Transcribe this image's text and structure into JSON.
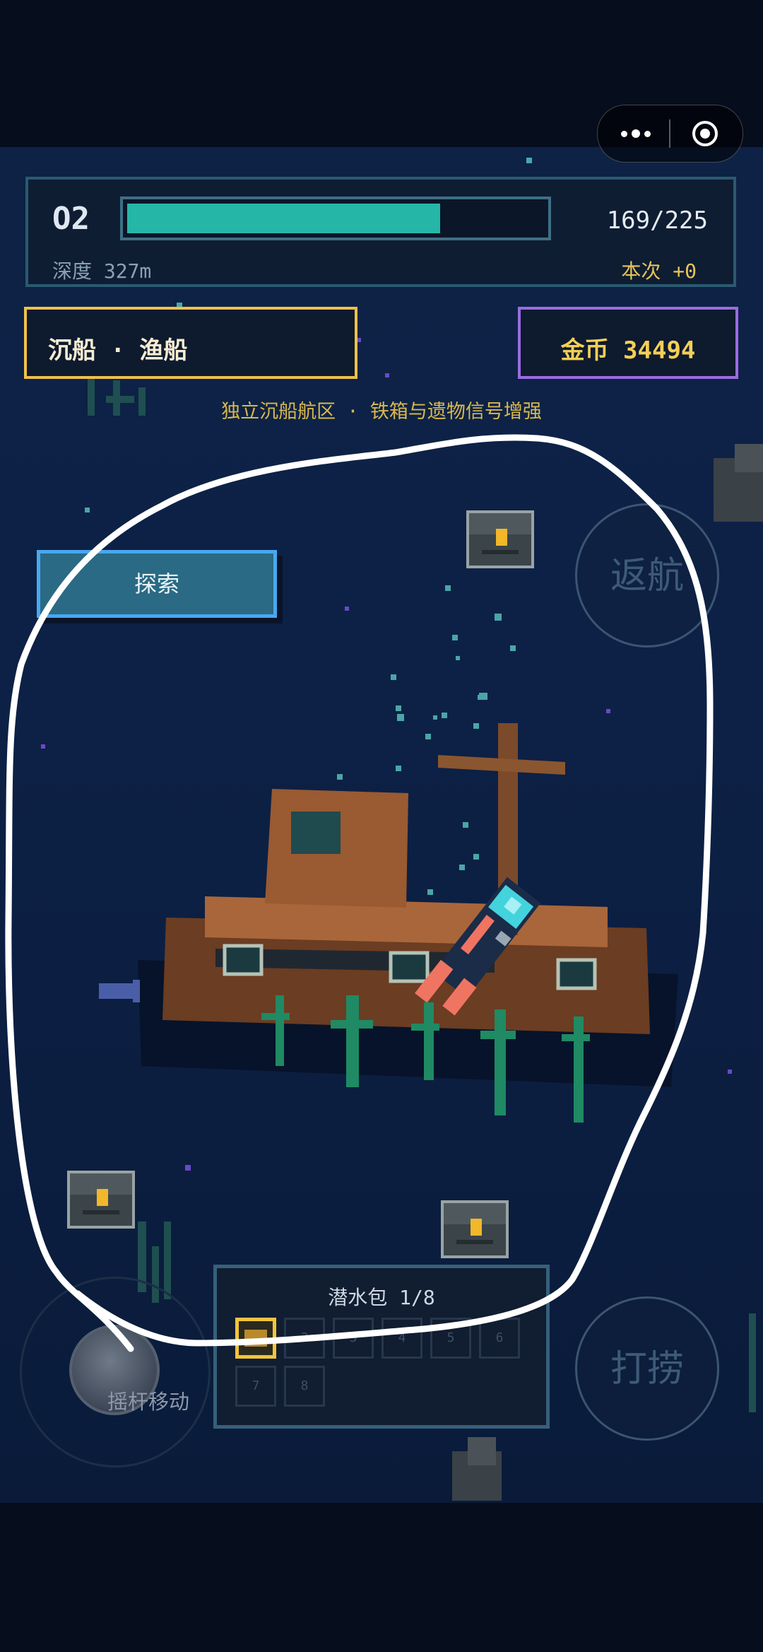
{
  "hud": {
    "o2_label": "O2",
    "o2_value": "169/225",
    "o2_fraction": 0.751,
    "depth": "深度 327m",
    "haul_count": "本次 +0"
  },
  "location": "沉船 · 渔船",
  "coins": "金币 34494",
  "zone_hint": "独立沉船航区 · 铁箱与遗物信号增强",
  "buttons": {
    "explore": "探索",
    "return": "返航",
    "haul": "打捞",
    "joystick": "摇杆移动"
  },
  "bag": {
    "title": "潜水包 1/8",
    "slots": [
      "1",
      "2",
      "3",
      "4",
      "5",
      "6",
      "7",
      "8"
    ]
  },
  "colors": {
    "o2_fill": "#25b6a8",
    "location_border": "#f0c04a",
    "coins_border": "#9a6ce0",
    "explore_border": "#4aa7f0"
  }
}
